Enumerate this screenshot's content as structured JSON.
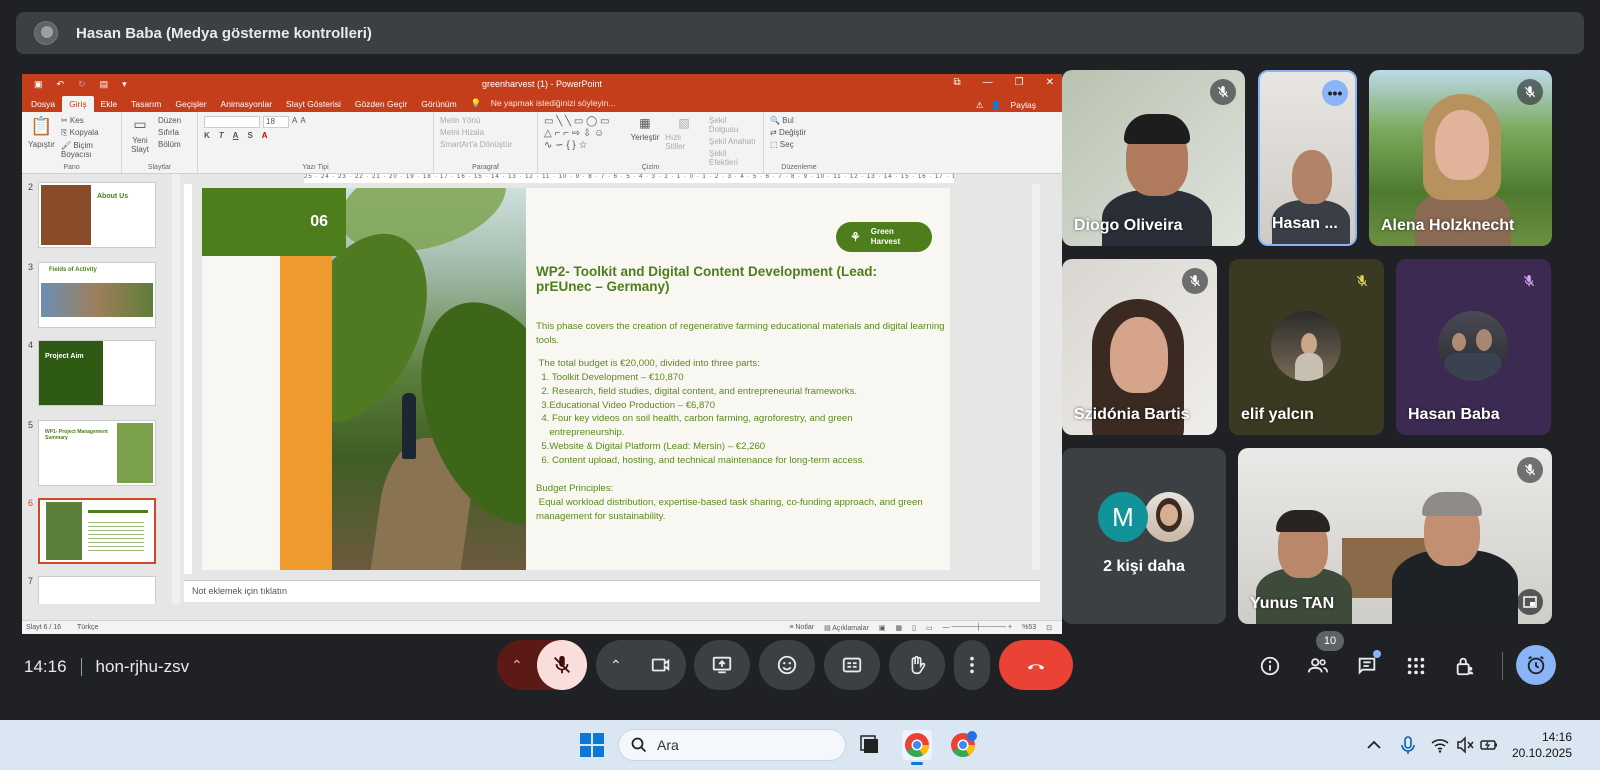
{
  "banner": {
    "title": "Hasan Baba (Medya gösterme kontrolleri)"
  },
  "ppt": {
    "window_title": "greenharvest (1) - PowerPoint",
    "tabs": [
      "Dosya",
      "Giriş",
      "Ekle",
      "Tasarım",
      "Geçişler",
      "Animasyonlar",
      "Slayt Gösterisi",
      "Gözden Geçir",
      "Görünüm"
    ],
    "tell_me": "Ne yapmak istediğinizi söyleyin...",
    "share": "Paylaş",
    "ribbon": {
      "paste": "Yapıştır",
      "cut": "Kes",
      "copy": "Kopyala",
      "format_painter": "Biçim Boyacısı",
      "pano": "Pano",
      "new_slide": "Yeni Slayt",
      "layout": "Düzen",
      "reset": "Sıfırla",
      "section": "Bölüm",
      "slides": "Slaytlar",
      "font_size": "18",
      "font": "Yazı Tipi",
      "text_dir": "Metin Yönü",
      "align_text": "Metni Hizala",
      "smartart": "SmartArt'a Dönüştür",
      "paragraph": "Paragraf",
      "arrange": "Yerleştir",
      "quick_styles": "Hızlı Stiller",
      "shape_fill": "Şekil Dolgusu",
      "shape_outline": "Şekil Anahatı",
      "shape_effects": "Şekil Efektleri",
      "drawing": "Çizim",
      "find": "Bul",
      "replace": "Değiştir",
      "select": "Seç",
      "editing": "Düzenleme"
    },
    "thumbs": [
      {
        "num": "2",
        "title": "About Us"
      },
      {
        "num": "3",
        "title": "Fields of Activity"
      },
      {
        "num": "4",
        "title": "Project Aim"
      },
      {
        "num": "5",
        "title": "WP1- Project Management Summary"
      },
      {
        "num": "6",
        "title": ""
      },
      {
        "num": "7",
        "title": ""
      }
    ],
    "ruler": "25 · 24 · 23 · 22 · 21 · 20 · 19 · 18 · 17 · 16 · 15 · 14 · 13 · 12 · 11 · 10 · 9 · 8 · 7 · 6 · 5 · 4 · 3 · 2 · 1 · 0 · 1 · 2 · 3 · 4 · 5 · 6 · 7 · 8 · 9 · 10 · 11 · 12 · 13 · 14 · 15 · 16 · 17 · 18 · 19 · 20 · 21 · 22 · 23 · 24 · 25",
    "slide": {
      "number": "06",
      "logo_line1": "Green",
      "logo_line2": "Harvest",
      "title": "WP2- Toolkit and Digital Content Development (Lead: prEUnec – Germany)",
      "intro": "This phase covers the creation of regenerative farming educational materials and digital learning tools.",
      "budget_intro": " The total budget is €20,000, divided into three parts:",
      "items": [
        "  1. Toolkit Development – €10,870",
        "  2. Research, field studies, digital content, and entrepreneurial frameworks.",
        "  3.Educational Video Production – €6,870",
        "  4. Four key videos on soil health, carbon farming, agroforestry, and green",
        "     entrepreneurship.",
        "  5.Website & Digital Platform (Lead: Mersin) – €2,260",
        "  6. Content upload, hosting, and technical maintenance for long-term access."
      ],
      "principles_title": "Budget Principles:",
      "principles": " Equal workload distribution, expertise-based task sharing, co-funding approach, and green management for sustainability."
    },
    "notes_placeholder": "Not eklemek için tıklatın",
    "status_slide": "Slayt 6 / 16",
    "status_lang": "Türkçe",
    "status_notes": "Notlar",
    "status_comments": "Açıklamalar",
    "zoom": "%53"
  },
  "participants": [
    {
      "name": "Diogo Oliveira"
    },
    {
      "name": "Hasan ..."
    },
    {
      "name": "Alena Holzknecht"
    },
    {
      "name": "Szidónia Bartis"
    },
    {
      "name": "elif yalcın"
    },
    {
      "name": "Hasan Baba"
    },
    {
      "name": "2 kişi daha",
      "initial": "M"
    },
    {
      "name": "Yunus TAN"
    }
  ],
  "meeting": {
    "time": "14:16",
    "code": "hon-rjhu-zsv",
    "participant_count": "10"
  },
  "taskbar": {
    "search": "Ara",
    "time": "14:16",
    "date": "20.10.2025"
  },
  "colors": {
    "accent_red": "#ea4335",
    "ppt_red": "#c43e1c",
    "slide_green": "#4e7d1b",
    "slide_orange": "#ef9a2c",
    "meet_bg": "#202124"
  }
}
